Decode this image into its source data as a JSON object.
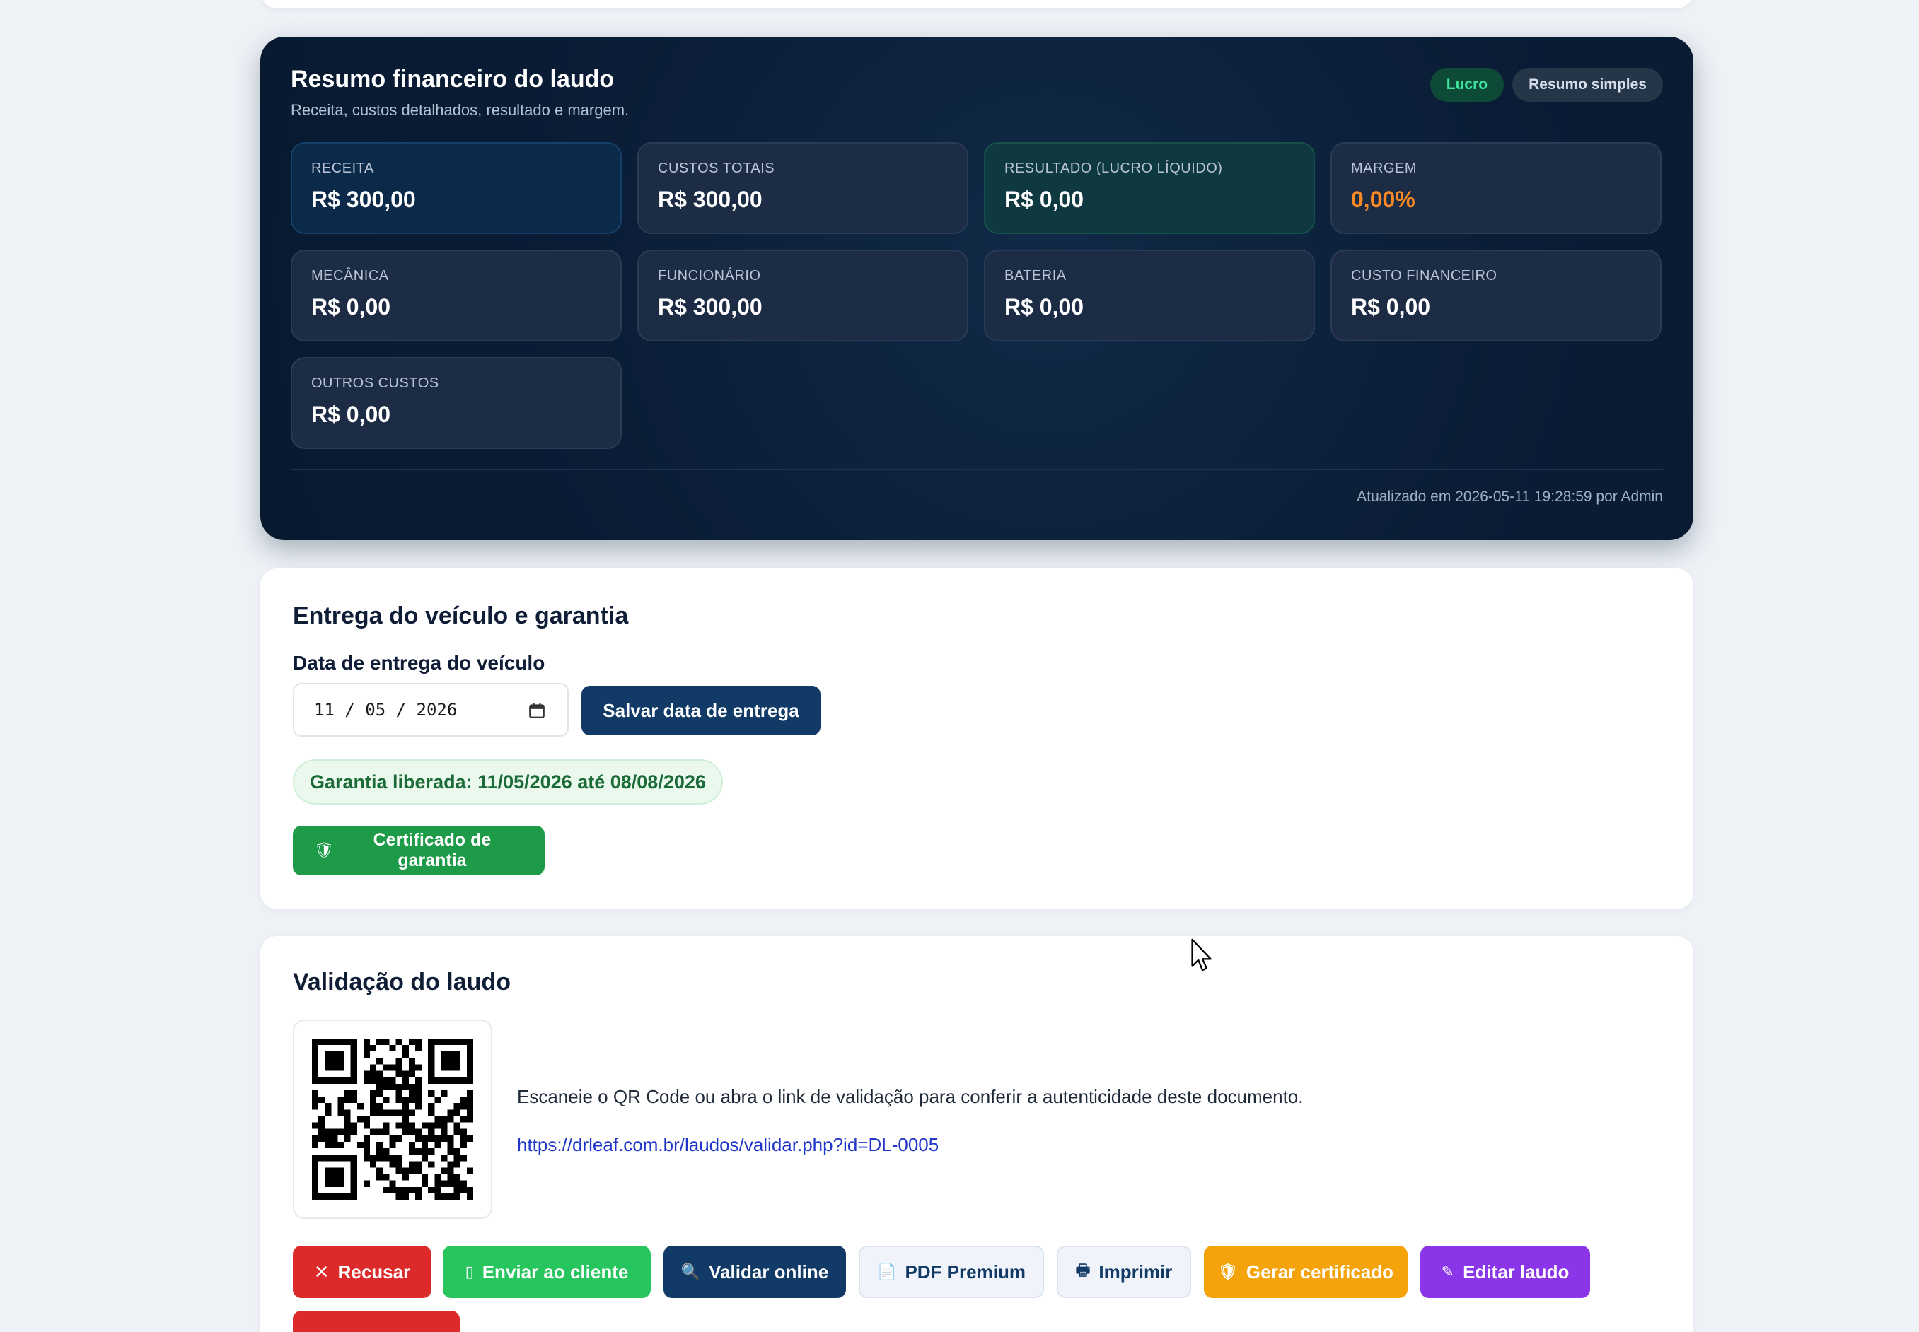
{
  "financial_summary": {
    "title": "Resumo financeiro do laudo",
    "subtitle": "Receita, custos detalhados, resultado e margem.",
    "badges": {
      "status": "Lucro",
      "view": "Resumo simples"
    },
    "tiles": [
      {
        "label": "RECEITA",
        "value": "R$ 300,00"
      },
      {
        "label": "CUSTOS TOTAIS",
        "value": "R$ 300,00"
      },
      {
        "label": "RESULTADO (LUCRO LÍQUIDO)",
        "value": "R$ 0,00"
      },
      {
        "label": "MARGEM",
        "value": "0,00%"
      },
      {
        "label": "MECÂNICA",
        "value": "R$ 0,00"
      },
      {
        "label": "FUNCIONÁRIO",
        "value": "R$ 300,00"
      },
      {
        "label": "BATERIA",
        "value": "R$ 0,00"
      },
      {
        "label": "CUSTO FINANCEIRO",
        "value": "R$ 0,00"
      },
      {
        "label": "OUTROS CUSTOS",
        "value": "R$ 0,00"
      }
    ],
    "updated": "Atualizado em 2026-05-11 19:28:59 por Admin"
  },
  "delivery": {
    "title": "Entrega do veículo e garantia",
    "date_label": "Data de entrega do veículo",
    "date_value": "11 / 05 / 2026",
    "save_button": "Salvar data de entrega",
    "warranty_status": "Garantia liberada: 11/05/2026 até 08/08/2026",
    "certificate_button": "Certificado de garantia"
  },
  "validation": {
    "title": "Validação do laudo",
    "description": "Escaneie o QR Code ou abra o link de validação para conferir a autenticidade deste documento.",
    "link": "https://drleaf.com.br/laudos/validar.php?id=DL-0005",
    "actions": {
      "refuse": "Recusar",
      "send": "Enviar ao cliente",
      "validate": "Validar online",
      "pdf": "PDF Premium",
      "print": "Imprimir",
      "generate": "Gerar certificado",
      "edit": "Editar laudo"
    }
  },
  "colors": {
    "accent_navy": "#123a67",
    "success": "#1e9b48",
    "danger": "#dc2a2a",
    "warning": "#f5a30b",
    "purple": "#8b35e8",
    "margin_orange": "#fb8a24"
  }
}
